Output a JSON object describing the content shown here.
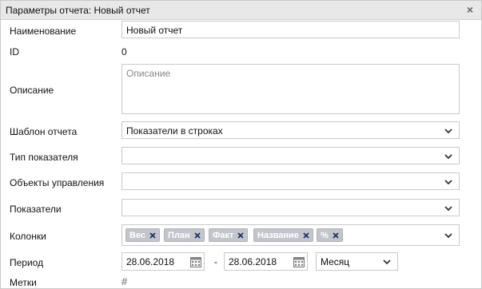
{
  "dialog": {
    "title": "Параметры отчета: Новый отчет",
    "close_symbol": "×"
  },
  "form": {
    "name": {
      "label": "Наименование",
      "value": "Новый отчет"
    },
    "id": {
      "label": "ID",
      "value": "0"
    },
    "description": {
      "label": "Описание",
      "placeholder": "Описание"
    },
    "template": {
      "label": "Шаблон отчета",
      "value": "Показатели в строках"
    },
    "indicator_type": {
      "label": "Тип показателя",
      "value": ""
    },
    "control_objects": {
      "label": "Объекты управления",
      "value": ""
    },
    "indicators": {
      "label": "Показатели",
      "value": ""
    },
    "columns": {
      "label": "Колонки",
      "chips": [
        "Вес",
        "План",
        "Факт",
        "Название",
        "%"
      ]
    },
    "period": {
      "label": "Период",
      "date_from": "28.06.2018",
      "separator": "-",
      "date_to": "28.06.2018",
      "granularity": "Месяц"
    },
    "tags": {
      "label": "Метки",
      "symbol": "#"
    }
  },
  "icons": {
    "close": "close-icon",
    "dropdown": "chevron-down-icon",
    "calendar": "calendar-icon",
    "chip_remove": "close-icon",
    "tag": "hash-icon"
  }
}
